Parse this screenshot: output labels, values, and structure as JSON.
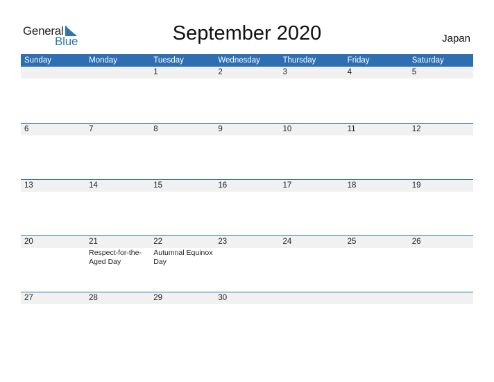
{
  "logo": {
    "word1": "General",
    "word2": "Blue"
  },
  "title": "September 2020",
  "country": "Japan",
  "colors": {
    "accent": "#2e6fb2",
    "date_strip": "#f1f1f1"
  },
  "weekdays": [
    "Sunday",
    "Monday",
    "Tuesday",
    "Wednesday",
    "Thursday",
    "Friday",
    "Saturday"
  ],
  "weeks": [
    {
      "days": [
        {
          "num": "",
          "holiday": ""
        },
        {
          "num": "",
          "holiday": ""
        },
        {
          "num": "1",
          "holiday": ""
        },
        {
          "num": "2",
          "holiday": ""
        },
        {
          "num": "3",
          "holiday": ""
        },
        {
          "num": "4",
          "holiday": ""
        },
        {
          "num": "5",
          "holiday": ""
        }
      ]
    },
    {
      "days": [
        {
          "num": "6",
          "holiday": ""
        },
        {
          "num": "7",
          "holiday": ""
        },
        {
          "num": "8",
          "holiday": ""
        },
        {
          "num": "9",
          "holiday": ""
        },
        {
          "num": "10",
          "holiday": ""
        },
        {
          "num": "11",
          "holiday": ""
        },
        {
          "num": "12",
          "holiday": ""
        }
      ]
    },
    {
      "days": [
        {
          "num": "13",
          "holiday": ""
        },
        {
          "num": "14",
          "holiday": ""
        },
        {
          "num": "15",
          "holiday": ""
        },
        {
          "num": "16",
          "holiday": ""
        },
        {
          "num": "17",
          "holiday": ""
        },
        {
          "num": "18",
          "holiday": ""
        },
        {
          "num": "19",
          "holiday": ""
        }
      ]
    },
    {
      "days": [
        {
          "num": "20",
          "holiday": ""
        },
        {
          "num": "21",
          "holiday": "Respect-for-the-Aged Day"
        },
        {
          "num": "22",
          "holiday": "Autumnal Equinox Day"
        },
        {
          "num": "23",
          "holiday": ""
        },
        {
          "num": "24",
          "holiday": ""
        },
        {
          "num": "25",
          "holiday": ""
        },
        {
          "num": "26",
          "holiday": ""
        }
      ]
    },
    {
      "days": [
        {
          "num": "27",
          "holiday": ""
        },
        {
          "num": "28",
          "holiday": ""
        },
        {
          "num": "29",
          "holiday": ""
        },
        {
          "num": "30",
          "holiday": ""
        },
        {
          "num": "",
          "holiday": ""
        },
        {
          "num": "",
          "holiday": ""
        },
        {
          "num": "",
          "holiday": ""
        }
      ]
    }
  ]
}
